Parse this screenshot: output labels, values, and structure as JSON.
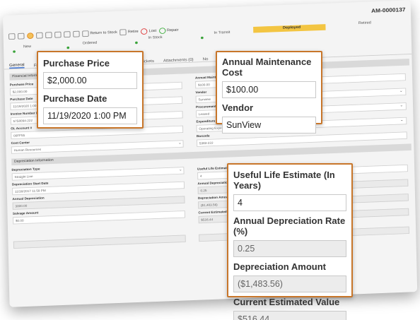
{
  "asset_id": "AM-0000137",
  "toolbar": {
    "return_label": "Return to Stock",
    "retire_label": "Retire",
    "lost_label": "Lost",
    "repair_label": "Repair"
  },
  "status_steps": [
    "New",
    "Ordered",
    "In Stock",
    "In Transit",
    "Deployed",
    "Retired"
  ],
  "tabs": [
    "General",
    "Fi",
    "Service Tickets",
    "Attachments (0)",
    "No"
  ],
  "sections": {
    "financial": "Financial Information",
    "depreciation": "Depreciation Information"
  },
  "left_fields": [
    {
      "label": "Purchase Price",
      "value": "$2,000.00"
    },
    {
      "label": "Purchase Date",
      "value": "11/19/2020 1:00"
    },
    {
      "label": "Invoice Number / PO#",
      "value": "5758094-222"
    },
    {
      "label": "GL Account #",
      "value": "00FF55"
    },
    {
      "label": "Cost Center",
      "value": "Human Resources"
    }
  ],
  "depr_fields": [
    {
      "label": "Depreciation Type",
      "value": "Straight Line"
    },
    {
      "label": "Depreciation Start Date",
      "value": "11/30/2017 11:59 PM"
    },
    {
      "label": "Annual Depreciation",
      "value": "3000.00"
    },
    {
      "label": "Salvage Amount",
      "value": "$0.00"
    }
  ],
  "right_fields": [
    {
      "label": "Annual Maint",
      "value": "$100.00"
    },
    {
      "label": "Vendor",
      "value": "Sunview"
    },
    {
      "label": "Procurement Source",
      "value": "Leased"
    },
    {
      "label": "Expenditure Type",
      "value": "Operating Expense"
    },
    {
      "label": "Barcode",
      "value": "5383-222"
    }
  ],
  "right_depr_fields": [
    {
      "label": "Useful Life Estimate",
      "value": "4"
    },
    {
      "label": "Annual Depreciation",
      "value": "0.25"
    },
    {
      "label": "Depreciation Amount",
      "value": "($1,483.56)"
    },
    {
      "label": "Current Estimated V",
      "value": "$516.44"
    }
  ],
  "callouts": {
    "purchase": {
      "price_label": "Purchase Price",
      "price_value": "$2,000.00",
      "date_label": "Purchase Date",
      "date_value": "11/19/2020 1:00 PM"
    },
    "maintenance": {
      "cost_label": "Annual Maintenance Cost",
      "cost_value": "$100.00",
      "vendor_label": "Vendor",
      "vendor_value": "SunView"
    },
    "depreciation": {
      "life_label": "Useful Life Estimate (In Years)",
      "life_value": "4",
      "rate_label": "Annual Depreciation Rate (%)",
      "rate_value": "0.25",
      "amount_label": "Depreciation Amount",
      "amount_value": "($1,483.56)",
      "current_label": "Current Estimated Value",
      "current_value": "$516.44"
    }
  },
  "colors": {
    "accent": "#c8762a",
    "deployed": "#f3c542",
    "status_dot": "#3aa33a"
  }
}
